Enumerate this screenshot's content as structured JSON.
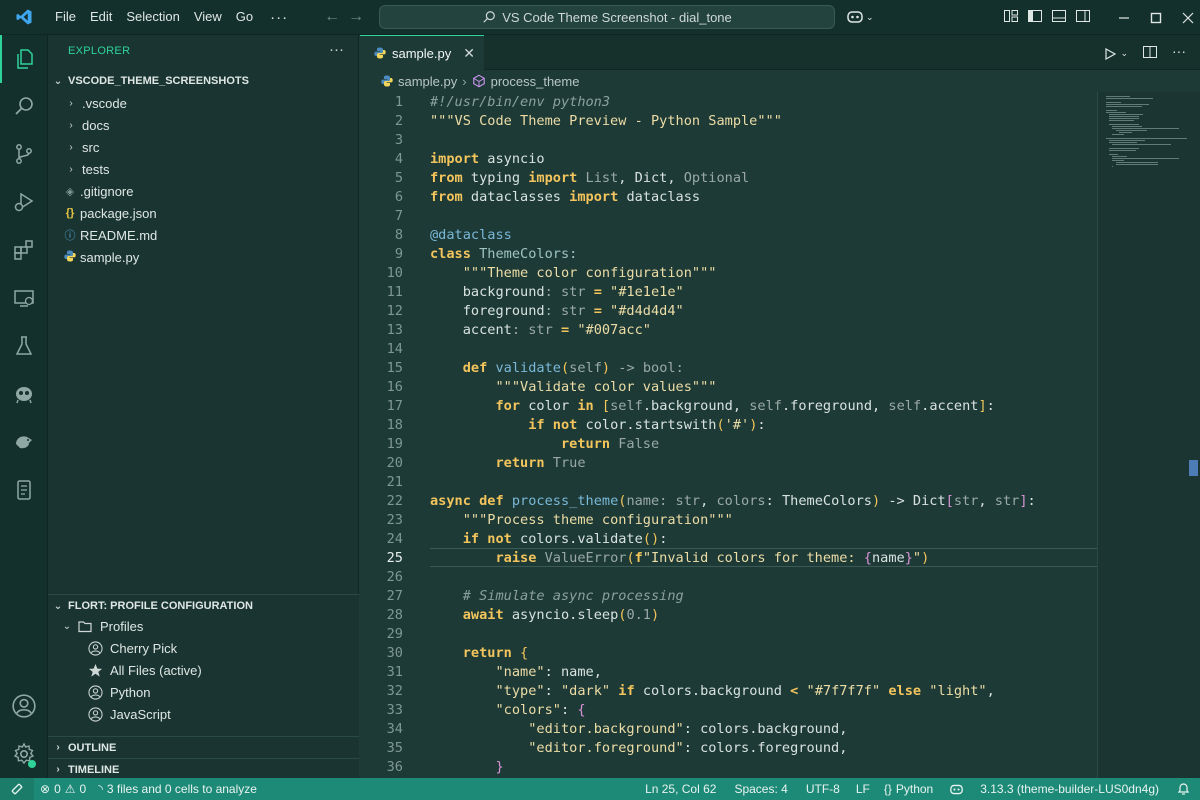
{
  "window": {
    "title": "VS Code Theme Screenshot - dial_tone",
    "menu": [
      "File",
      "Edit",
      "Selection",
      "View",
      "Go"
    ],
    "menu_more": "···"
  },
  "explorer": {
    "title": "EXPLORER",
    "more": "···",
    "root": "VSCODE_THEME_SCREENSHOTS",
    "items": [
      {
        "label": ".vscode",
        "type": "folder"
      },
      {
        "label": "docs",
        "type": "folder"
      },
      {
        "label": "src",
        "type": "folder"
      },
      {
        "label": "tests",
        "type": "folder"
      },
      {
        "label": ".gitignore",
        "type": "file",
        "icon": "◈"
      },
      {
        "label": "package.json",
        "type": "file",
        "icon": "{}"
      },
      {
        "label": "README.md",
        "type": "file",
        "icon": "ⓘ"
      },
      {
        "label": "sample.py",
        "type": "file",
        "icon": "py"
      }
    ]
  },
  "profiles": {
    "section_title": "FLORT: PROFILE CONFIGURATION",
    "folder": "Profiles",
    "items": [
      "Cherry Pick",
      "All Files (active)",
      "Python",
      "JavaScript"
    ]
  },
  "outline": {
    "title": "OUTLINE"
  },
  "timeline": {
    "title": "TIMELINE"
  },
  "editor": {
    "tab": "sample.py",
    "breadcrumb": {
      "file": "sample.py",
      "symbol": "process_theme"
    },
    "current_line": 25,
    "lines": [
      [
        [
          "cmt",
          "#!/usr/bin/env python3"
        ]
      ],
      [
        [
          "str",
          "\"\"\"VS Code Theme Preview - Python Sample\"\"\""
        ]
      ],
      [],
      [
        [
          "kw",
          "import"
        ],
        [
          "",
          " asyncio"
        ]
      ],
      [
        [
          "kw",
          "from"
        ],
        [
          "",
          " typing "
        ],
        [
          "kw",
          "import"
        ],
        [
          "dim",
          " List"
        ],
        [
          "",
          ", Dict, "
        ],
        [
          "dim",
          "Optional"
        ]
      ],
      [
        [
          "kw",
          "from"
        ],
        [
          "",
          " dataclasses "
        ],
        [
          "kw",
          "import"
        ],
        [
          "",
          " dataclass"
        ]
      ],
      [],
      [
        [
          "fn",
          "@dataclass"
        ]
      ],
      [
        [
          "kw",
          "class"
        ],
        [
          "cls",
          " ThemeColors:"
        ]
      ],
      [
        [
          "",
          "    "
        ],
        [
          "str",
          "\"\"\"Theme color configuration\"\"\""
        ]
      ],
      [
        [
          "",
          "    background"
        ],
        [
          "dim",
          ": str "
        ],
        [
          "kw",
          "="
        ],
        [
          "str",
          " \"#1e1e1e\""
        ]
      ],
      [
        [
          "",
          "    foreground"
        ],
        [
          "dim",
          ": str "
        ],
        [
          "kw",
          "="
        ],
        [
          "str",
          " \"#d4d4d4\""
        ]
      ],
      [
        [
          "",
          "    accent"
        ],
        [
          "dim",
          ": str "
        ],
        [
          "kw",
          "="
        ],
        [
          "str",
          " \"#007acc\""
        ]
      ],
      [],
      [
        [
          "",
          "    "
        ],
        [
          "kw",
          "def"
        ],
        [
          "fn",
          " validate"
        ],
        [
          "br1",
          "("
        ],
        [
          "dim",
          "self"
        ],
        [
          "br1",
          ")"
        ],
        [
          "dim",
          " -> bool:"
        ]
      ],
      [
        [
          "",
          "        "
        ],
        [
          "str",
          "\"\"\"Validate color values\"\"\""
        ]
      ],
      [
        [
          "",
          "        "
        ],
        [
          "kw",
          "for"
        ],
        [
          "",
          " color "
        ],
        [
          "kw",
          "in"
        ],
        [
          "",
          " "
        ],
        [
          "br1",
          "["
        ],
        [
          "dim",
          "self"
        ],
        [
          "",
          ".background, "
        ],
        [
          "dim",
          "self"
        ],
        [
          "",
          ".foreground, "
        ],
        [
          "dim",
          "self"
        ],
        [
          "",
          ".accent"
        ],
        [
          "br1",
          "]"
        ],
        [
          "",
          ":"
        ]
      ],
      [
        [
          "",
          "            "
        ],
        [
          "kw",
          "if not"
        ],
        [
          "",
          " color.startswith"
        ],
        [
          "br1",
          "("
        ],
        [
          "str",
          "'#'"
        ],
        [
          "br1",
          ")"
        ],
        [
          "",
          ":"
        ]
      ],
      [
        [
          "",
          "                "
        ],
        [
          "kw",
          "return"
        ],
        [
          "dim",
          " False"
        ]
      ],
      [
        [
          "",
          "        "
        ],
        [
          "kw",
          "return"
        ],
        [
          "dim",
          " True"
        ]
      ],
      [],
      [
        [
          "kw",
          "async def"
        ],
        [
          "fn",
          " process_theme"
        ],
        [
          "br1",
          "("
        ],
        [
          "dim",
          "name: str"
        ],
        [
          "",
          ", "
        ],
        [
          "dim",
          "colors"
        ],
        [
          "",
          ": ThemeColors"
        ],
        [
          "br1",
          ")"
        ],
        [
          "",
          " -> Dict"
        ],
        [
          "br2",
          "["
        ],
        [
          "dim",
          "str"
        ],
        [
          "",
          ", "
        ],
        [
          "dim",
          "str"
        ],
        [
          "br2",
          "]"
        ],
        [
          "",
          ":"
        ]
      ],
      [
        [
          "",
          "    "
        ],
        [
          "str",
          "\"\"\"Process theme configuration\"\"\""
        ]
      ],
      [
        [
          "",
          "    "
        ],
        [
          "kw",
          "if not"
        ],
        [
          "",
          " colors.validate"
        ],
        [
          "br1",
          "()"
        ],
        [
          "",
          ":"
        ]
      ],
      [
        [
          "",
          "        "
        ],
        [
          "kw",
          "raise"
        ],
        [
          "dim",
          " ValueError"
        ],
        [
          "br1",
          "("
        ],
        [
          "kw",
          "f"
        ],
        [
          "str",
          "\"Invalid colors for theme: "
        ],
        [
          "br2",
          "{"
        ],
        [
          "",
          "name"
        ],
        [
          "br2",
          "}"
        ],
        [
          "str",
          "\""
        ],
        [
          "br1",
          ")"
        ]
      ],
      [],
      [
        [
          "",
          "    "
        ],
        [
          "cmt",
          "# Simulate async processing"
        ]
      ],
      [
        [
          "",
          "    "
        ],
        [
          "kw",
          "await"
        ],
        [
          "",
          " asyncio.sleep"
        ],
        [
          "br1",
          "("
        ],
        [
          "dim",
          "0.1"
        ],
        [
          "br1",
          ")"
        ]
      ],
      [],
      [
        [
          "",
          "    "
        ],
        [
          "kw",
          "return"
        ],
        [
          "",
          " "
        ],
        [
          "br1",
          "{"
        ]
      ],
      [
        [
          "",
          "        "
        ],
        [
          "str",
          "\"name\""
        ],
        [
          "",
          ": name,"
        ]
      ],
      [
        [
          "",
          "        "
        ],
        [
          "str",
          "\"type\""
        ],
        [
          "",
          ": "
        ],
        [
          "str",
          "\"dark\""
        ],
        [
          "",
          " "
        ],
        [
          "kw",
          "if"
        ],
        [
          "",
          " colors.background "
        ],
        [
          "kw",
          "<"
        ],
        [
          "str",
          " \"#7f7f7f\""
        ],
        [
          "",
          " "
        ],
        [
          "kw",
          "else"
        ],
        [
          "str",
          " \"light\""
        ],
        [
          "",
          ","
        ]
      ],
      [
        [
          "",
          "        "
        ],
        [
          "str",
          "\"colors\""
        ],
        [
          "",
          ": "
        ],
        [
          "br2",
          "{"
        ]
      ],
      [
        [
          "",
          "            "
        ],
        [
          "str",
          "\"editor.background\""
        ],
        [
          "",
          ": colors.background,"
        ]
      ],
      [
        [
          "",
          "            "
        ],
        [
          "str",
          "\"editor.foreground\""
        ],
        [
          "",
          ": colors.foreground,"
        ]
      ],
      [
        [
          "",
          "        "
        ],
        [
          "br2",
          "}"
        ]
      ]
    ]
  },
  "statusbar": {
    "problems_errors": "0",
    "problems_warnings": "0",
    "analysis": "3 files and 0 cells to analyze",
    "position": "Ln 25, Col 62",
    "spaces": "Spaces: 4",
    "encoding": "UTF-8",
    "eol": "LF",
    "language": "Python",
    "interpreter": "3.13.3 (theme-builder-LUS0dn4g)"
  },
  "colors": {
    "accent": "#2fd39a",
    "statusbar": "#1d8a77",
    "editor_bg": "#1d3a36",
    "keyword": "#f3c55c"
  }
}
